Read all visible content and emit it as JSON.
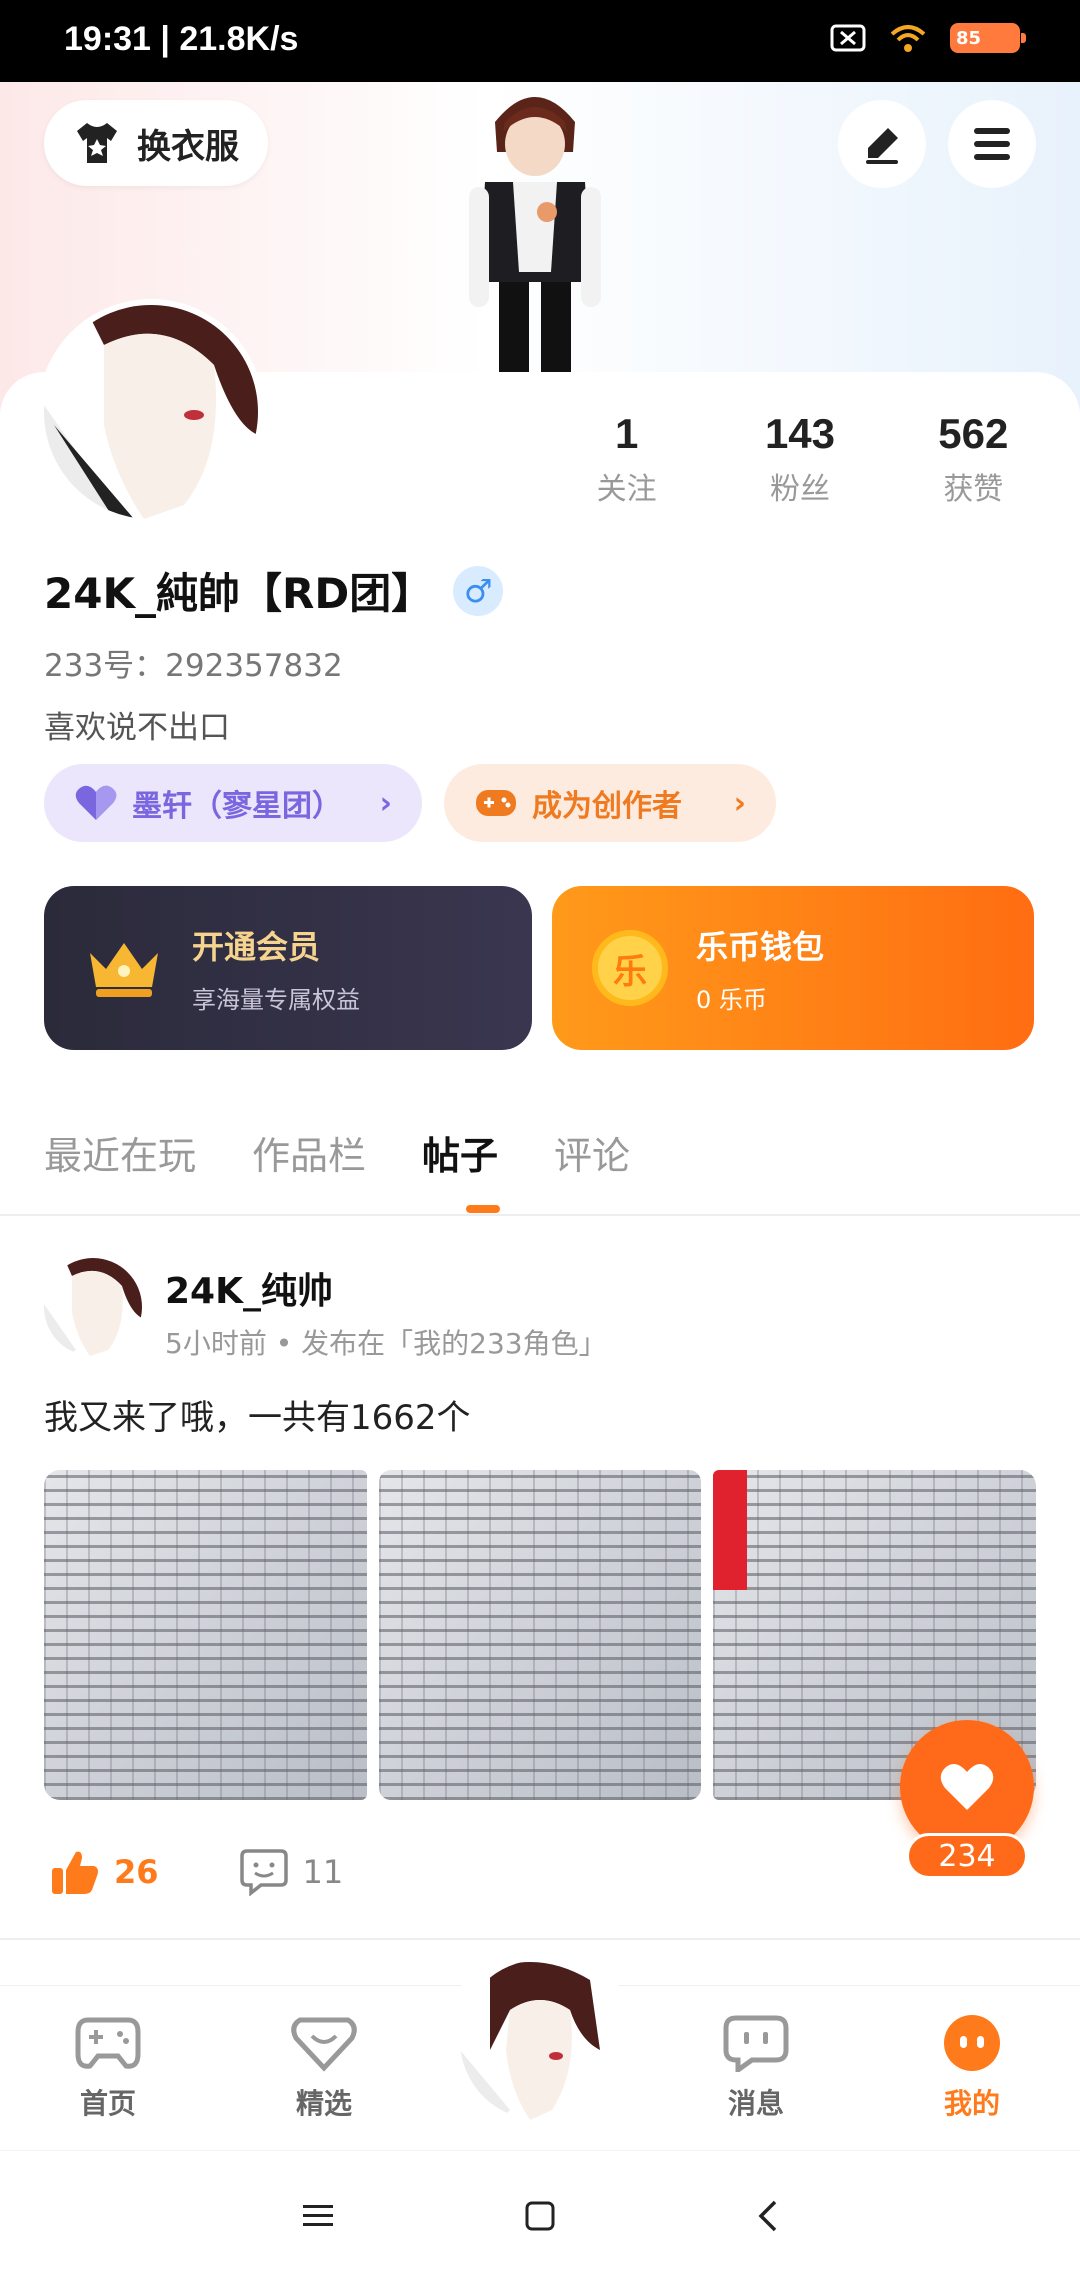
{
  "status_bar": {
    "time": "19:31 | 21.8K/s",
    "battery": "85"
  },
  "header": {
    "outfit_label": "换衣服"
  },
  "profile": {
    "stats": [
      {
        "value": "1",
        "label": "关注"
      },
      {
        "value": "143",
        "label": "粉丝"
      },
      {
        "value": "562",
        "label": "获赞"
      }
    ],
    "name": "24K_純帥【RD团】",
    "gender_symbol": "♂",
    "uid": "233号：292357832",
    "bio": "喜欢说不出口",
    "group_chip": "墨轩（寥星团）",
    "creator_chip": "成为创作者"
  },
  "cards": {
    "vip": {
      "title": "开通会员",
      "subtitle": "享海量专属权益"
    },
    "wallet": {
      "coin_glyph": "乐",
      "title": "乐币钱包",
      "subtitle": "0 乐币"
    }
  },
  "tabs": [
    "最近在玩",
    "作品栏",
    "帖子",
    "评论"
  ],
  "post": {
    "author": "24K_纯帅",
    "meta": "5小时前 • 发布在「我的233角色」",
    "text": "我又来了哦，一共有1662个",
    "likes": "26",
    "comments": "11",
    "fab_count": "234"
  },
  "bottom_nav": [
    {
      "label": "首页"
    },
    {
      "label": "精选"
    },
    {
      "label": "消息"
    },
    {
      "label": "我的"
    }
  ],
  "colors": {
    "accent": "#ff7a1a",
    "vip_bg": "#2b2a3a",
    "group_chip": "#7a67e0"
  }
}
